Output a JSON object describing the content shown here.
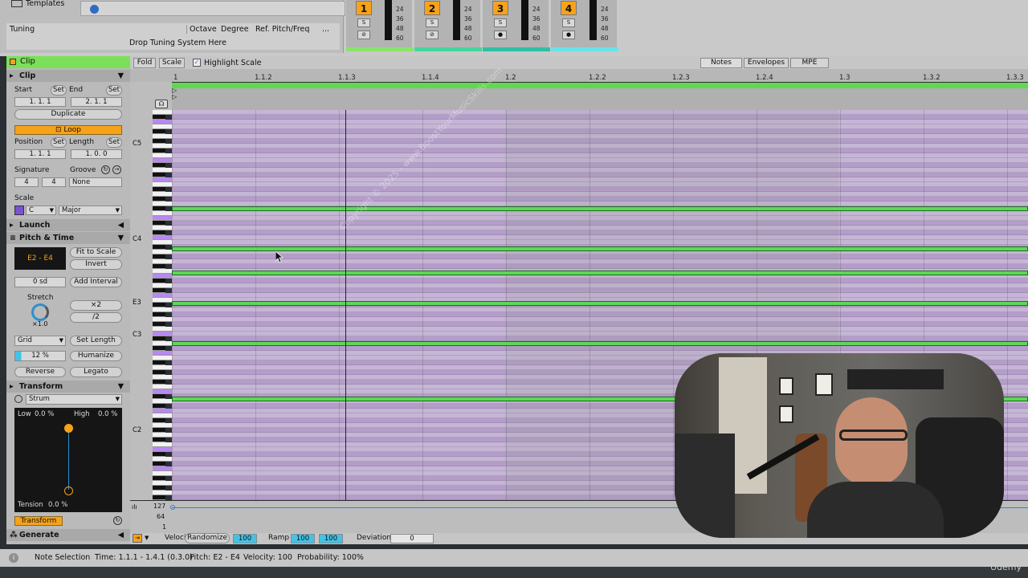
{
  "top": {
    "templates_label": "Templates",
    "tuning_label": "Tuning",
    "tuning_cols": [
      "Octave",
      "Degree",
      "Ref. Pitch/Freq",
      "..."
    ],
    "drop_text": "Drop Tuning System Here",
    "tracks": [
      {
        "num": "1",
        "bar_color": "#8be36a"
      },
      {
        "num": "2",
        "bar_color": "#45d6a0"
      },
      {
        "num": "3",
        "bar_color": "#2fbfa5"
      },
      {
        "num": "4",
        "bar_color": "#68e3e8"
      }
    ],
    "meter_scale": [
      "24",
      "36",
      "48",
      "60"
    ],
    "solo_label": "S"
  },
  "clip": {
    "header": "Clip",
    "section": "Clip",
    "start_label": "Start",
    "end_label": "End",
    "set_label": "Set",
    "start_value": "1.   1.   1",
    "end_value": "2.   1.   1",
    "duplicate": "Duplicate",
    "loop": "Loop",
    "position_label": "Position",
    "length_label": "Length",
    "position_value": "1.   1.   1",
    "length_value": "1.   0.   0",
    "signature_label": "Signature",
    "groove_label": "Groove",
    "sig_num": "4",
    "sig_den": "4",
    "groove_value": "None",
    "scale_label": "Scale",
    "scale_root": "C",
    "scale_mode": "Major",
    "launch": "Launch",
    "pitch_time": "Pitch & Time",
    "range": "E2 - E4",
    "fit_to_scale": "Fit to Scale",
    "invert": "Invert",
    "sd_value": "0 sd",
    "add_interval": "Add Interval",
    "stretch_label": "Stretch",
    "stretch_value": "×1.0",
    "x2": "×2",
    "half": "/2",
    "grid_label": "Grid",
    "set_length": "Set Length",
    "percent": "12 %",
    "humanize": "Humanize",
    "reverse": "Reverse",
    "legato": "Legato",
    "transform_header": "Transform",
    "strum": "Strum",
    "low_label": "Low",
    "low_value": "0.0 %",
    "high_label": "High",
    "high_value": "0.0 %",
    "tension_label": "Tension",
    "tension_value": "0.0 %",
    "transform_btn": "Transform",
    "generate": "Generate"
  },
  "toolbar": {
    "fold": "Fold",
    "scale": "Scale",
    "highlight": "Highlight Scale",
    "notes": "Notes",
    "envelopes": "Envelopes",
    "mpe": "MPE"
  },
  "ruler": [
    "1",
    "1.1.2",
    "1.1.3",
    "1.1.4",
    "1.2",
    "1.2.2",
    "1.2.3",
    "1.2.4",
    "1.3",
    "1.3.2",
    "1.3.3"
  ],
  "octave_labels": [
    "C5",
    "C4",
    "E3",
    "C3",
    "C2"
  ],
  "velocity_scale": [
    "127",
    "64",
    "1"
  ],
  "vel_bar": {
    "velocity": "Velocity",
    "randomize": "Randomize",
    "vel_value": "100",
    "ramp": "Ramp",
    "ramp_a": "100",
    "ramp_b": "100",
    "deviation": "Deviation",
    "dev_value": "0"
  },
  "status": {
    "selection": "Note Selection",
    "time": "Time: 1.1.1 - 1.4.1 (0.3.0)",
    "pitch": "Pitch: E2 - E4",
    "velocity": "Velocity: 100",
    "probability": "Probability: 100%"
  },
  "watermark": "Copyright © 2025 - www.BoostYourMusicSkills.com",
  "brand": "Udemy"
}
